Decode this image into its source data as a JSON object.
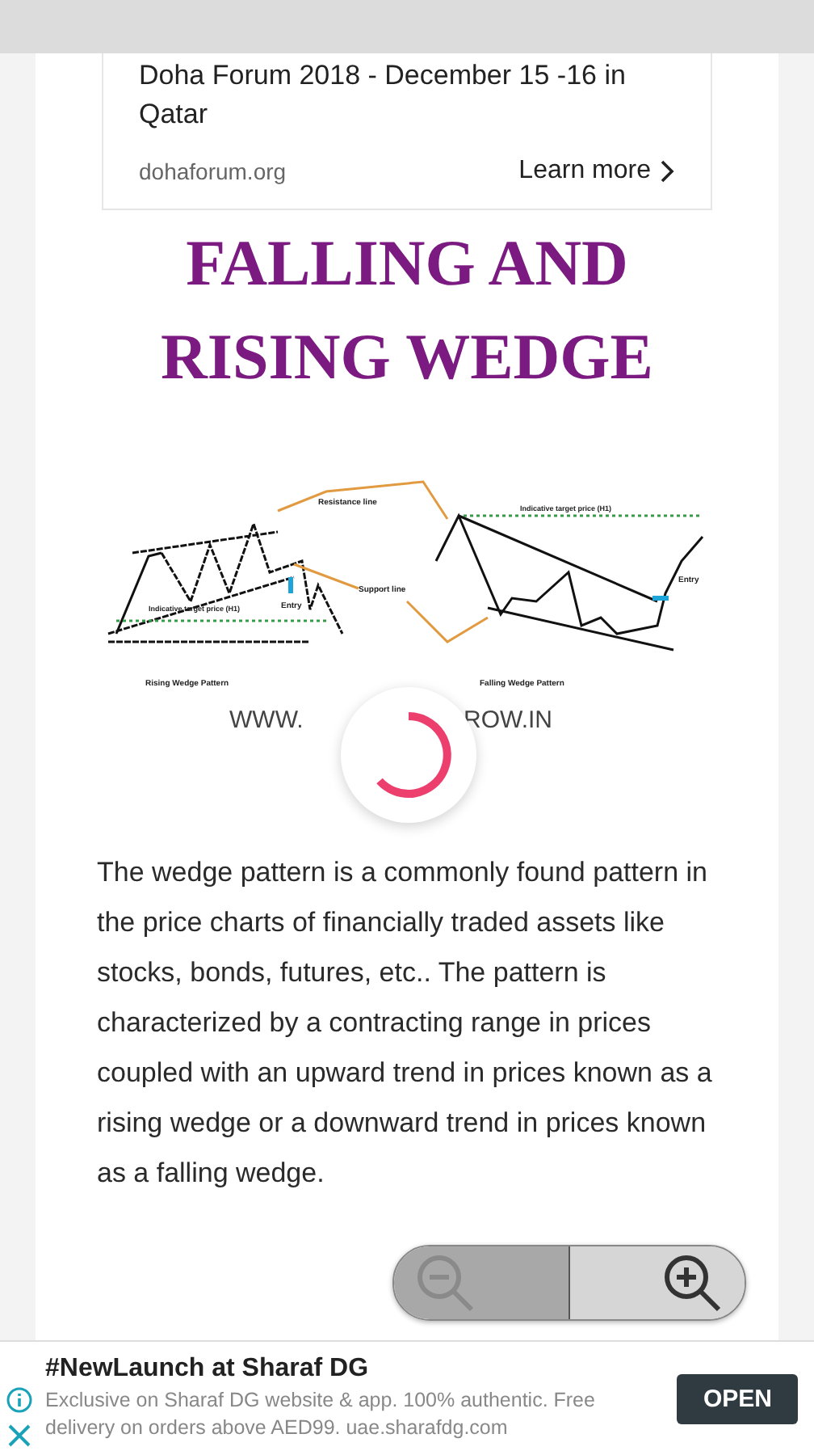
{
  "ad_card": {
    "headline": "Doha Forum 2018 - December 15 -16 in Qatar",
    "domain": "dohaforum.org",
    "cta": "Learn more"
  },
  "article": {
    "title": "FALLING AND RISING WEDGE",
    "diagram": {
      "labels": [
        "Resistance line",
        "Support line",
        "Indicative target price (H1)",
        "Indicative target price (H1)",
        "Entry",
        "Entry",
        "Rising Wedge Pattern",
        "Falling Wedge Pattern"
      ],
      "site_left": "WWW.",
      "site_right": "ROW.IN"
    },
    "paragraph": "The wedge pattern is a commonly found pattern in the price charts of financially traded assets  like stocks, bonds, futures, etc.. The pattern is characterized by a contracting range in prices coupled with an upward trend in prices known as a rising wedge or a downward trend in prices known as a falling wedge."
  },
  "loading": true,
  "zoom_controls": {
    "zoom_out_disabled": true
  },
  "bottom_ad": {
    "title": "#NewLaunch at Sharaf DG",
    "body": "Exclusive on Sharaf DG website & app. 100% authentic. Free delivery on orders above AED99. uae.sharafdg.com",
    "button": "OPEN"
  }
}
